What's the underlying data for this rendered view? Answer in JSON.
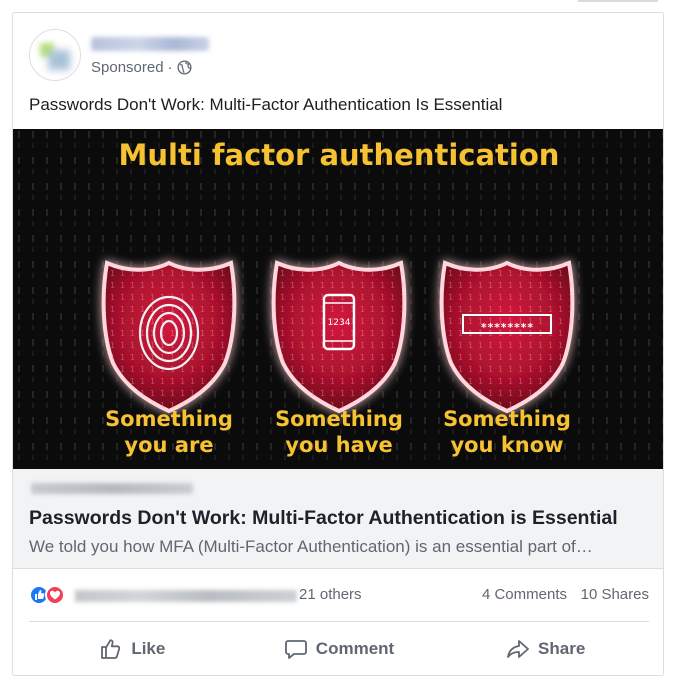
{
  "post": {
    "sponsored_label": "Sponsored",
    "separator": "·",
    "text": "Passwords Don't Work: Multi-Factor Authentication Is Essential"
  },
  "image": {
    "headline": "Multi factor authentication",
    "pin_digits": "1234",
    "password_mask": "********",
    "shields": [
      {
        "line1": "Something",
        "line2": "you are"
      },
      {
        "line1": "Something",
        "line2": "you have"
      },
      {
        "line1": "Something",
        "line2": "you know"
      }
    ]
  },
  "link": {
    "title": "Passwords Don't Work: Multi-Factor Authentication is Essential",
    "description": "We told you how MFA (Multi-Factor Authentication) is an essential part of…"
  },
  "stats": {
    "others": "21 others",
    "comments": "4 Comments",
    "shares": "10 Shares"
  },
  "actions": {
    "like": "Like",
    "comment": "Comment",
    "share": "Share"
  },
  "icons": {
    "globe": "globe-icon",
    "like_reaction": "like-reaction-icon",
    "love_reaction": "love-reaction-icon",
    "thumbs_up": "thumbs-up-icon",
    "comment": "comment-icon",
    "share": "share-icon",
    "fingerprint": "fingerprint-icon",
    "phone": "phone-icon"
  },
  "colors": {
    "accent_blue": "#1877f2",
    "love_red": "#f33e58",
    "headline_yellow": "#f7c231",
    "shield_red": "#a8112d",
    "link_box_bg": "#f2f3f5"
  }
}
